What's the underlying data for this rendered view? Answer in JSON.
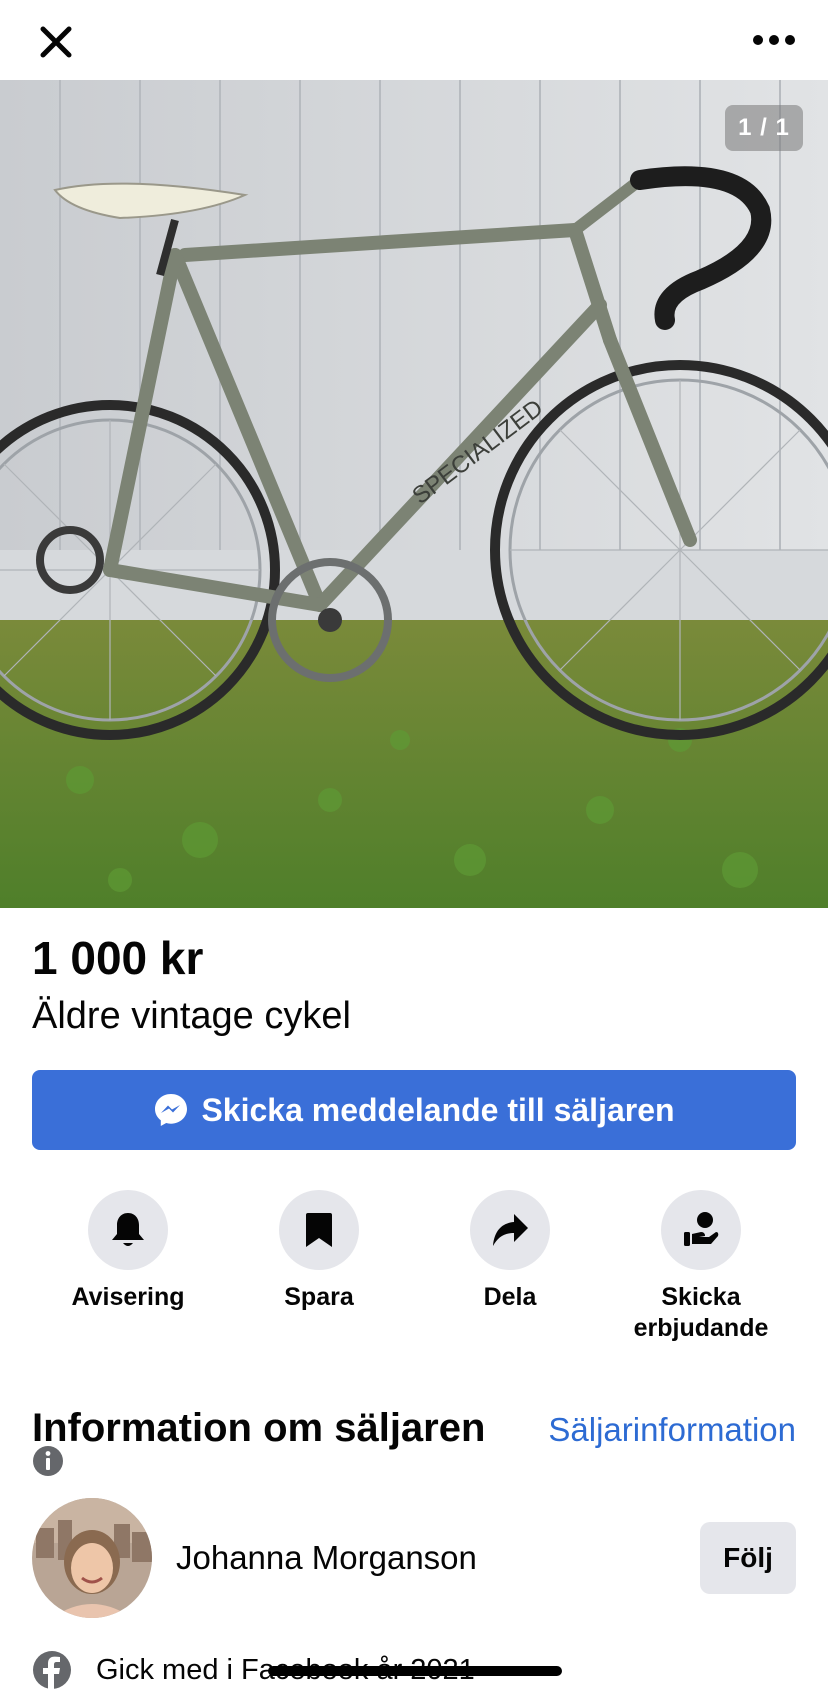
{
  "topbar": {
    "close_icon": "close-icon",
    "more_icon": "more-horizontal-icon"
  },
  "photo": {
    "counter": "1 / 1",
    "subject": "vintage road bicycle"
  },
  "listing": {
    "price": "1 000 kr",
    "title": "Äldre vintage cykel",
    "message_button": "Skicka meddelande till säljaren",
    "message_icon": "messenger-icon"
  },
  "actions": [
    {
      "label": "Avisering",
      "icon": "bell-icon"
    },
    {
      "label": "Spara",
      "icon": "bookmark-icon"
    },
    {
      "label": "Dela",
      "icon": "share-icon"
    },
    {
      "label": "Skicka\nerbjudande",
      "icon": "offer-hand-icon"
    }
  ],
  "seller": {
    "section_title": "Information om säljaren",
    "info_link": "Säljarinformation",
    "name": "Johanna Morganson",
    "follow_label": "Följ",
    "joined": "Gick med i Facebook år 2021"
  },
  "colors": {
    "accent": "#3a6fd8",
    "link": "#2d6bd3",
    "button_gray": "#e5e6eb"
  }
}
